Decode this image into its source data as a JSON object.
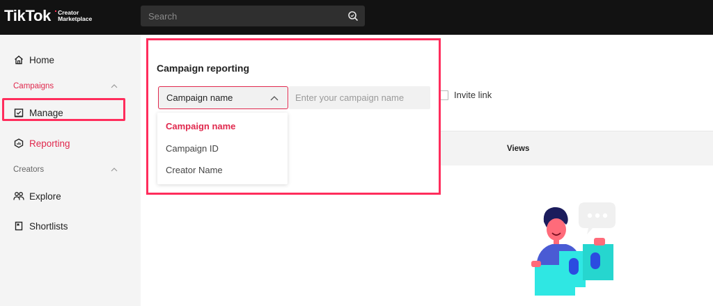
{
  "header": {
    "logo_main": "TikTok",
    "logo_sub": "Creator Marketplace",
    "search_placeholder": "Search"
  },
  "sidebar": {
    "home": "Home",
    "campaigns_section": "Campaigns",
    "manage": "Manage",
    "reporting": "Reporting",
    "creators_section": "Creators",
    "explore": "Explore",
    "shortlists": "Shortlists"
  },
  "reporting_panel": {
    "title": "Campaign reporting",
    "selected_filter": "Campaign name",
    "input_placeholder": "Enter your campaign name",
    "options": [
      "Campaign name",
      "Campaign ID",
      "Creator Name"
    ]
  },
  "main": {
    "invite_link_label": "Invite link",
    "views_column": "Views"
  },
  "colors": {
    "accent": "#e0284d",
    "highlight": "#ff2d5c",
    "topbar": "#121212"
  }
}
